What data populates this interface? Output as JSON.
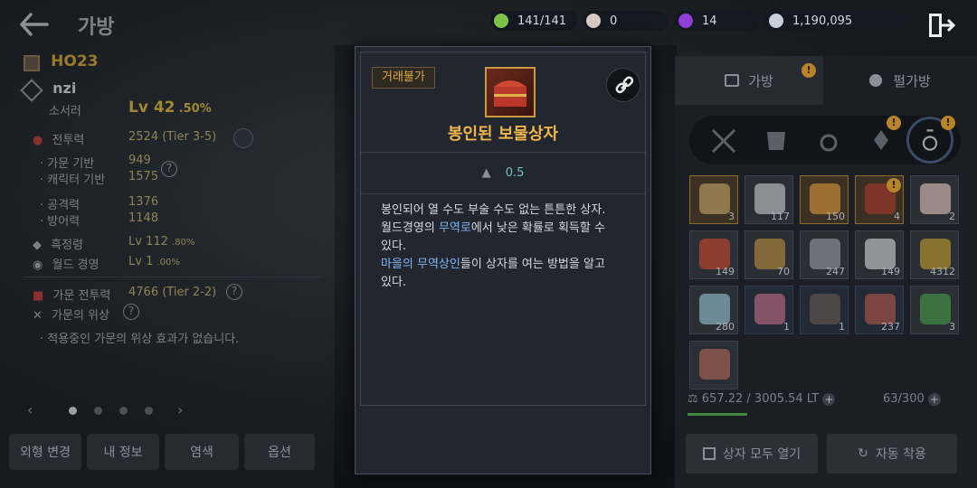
{
  "header": {
    "title": "가방",
    "back_icon": "back-arrow-icon",
    "exit_icon": "exit-door-icon"
  },
  "currencies": [
    {
      "name": "stamina",
      "icon": "stamina-icon",
      "value": "141/141",
      "color": "#7fc24a"
    },
    {
      "name": "pearl",
      "icon": "pearl-icon",
      "value": "0",
      "color": "#d9c9c4"
    },
    {
      "name": "purple-crystal",
      "icon": "purple-crystal-icon",
      "value": "14",
      "color": "#8e3fd6"
    },
    {
      "name": "silver",
      "icon": "silver-coin-icon",
      "value": "1,190,095",
      "color": "#c8d0dc"
    }
  ],
  "character": {
    "guild_name": "HO23",
    "name": "nzi",
    "class": "소서러",
    "level": "Lv 42",
    "level_pct": ".50%",
    "stats": [
      {
        "label": "전투력",
        "value": "2524 (Tier 3-5)"
      },
      {
        "label": "가문 기반",
        "value": "949"
      },
      {
        "label": "캐릭터 기반",
        "value": "1575"
      },
      {
        "label": "공격력",
        "value": "1376"
      },
      {
        "label": "방어력",
        "value": "1148"
      },
      {
        "label": "흑정령",
        "value": "Lv 112",
        "pct": ".80%"
      },
      {
        "label": "월드 경영",
        "value": "Lv 1",
        "pct": ".00%"
      },
      {
        "label": "가문 전투력",
        "value": "4766 (Tier 2-2)"
      },
      {
        "label": "가문의 위상",
        "value": ""
      }
    ],
    "status_note": "적용중인 가문의 위상 효과가 없습니다."
  },
  "left_buttons": [
    "외형 변경",
    "내 정보",
    "염색",
    "옵션"
  ],
  "item_popup": {
    "badge": "거래불가",
    "title": "봉인된 보물상자",
    "weight": "0.5",
    "desc_line1": "봉인되어 열 수도 부술 수도 없는 튼튼한 상자.",
    "desc_line2_pre": "월드경영의 ",
    "desc_line2_hl": "무역로",
    "desc_line2_post": "에서 낮은 확률로 획득할 수",
    "desc_line3": "있다.",
    "desc_line4_hl": "마을의 무역상인",
    "desc_line4_post": "들이 상자를 여는 방법을 알고",
    "desc_line5": "있다."
  },
  "inventory": {
    "tabs": [
      {
        "label": "가방",
        "icon": "bag-icon",
        "alert": "!"
      },
      {
        "label": "펄가방",
        "icon": "pearl-bag-icon",
        "alert": ""
      }
    ],
    "categories": [
      {
        "icon": "crossed-swords-icon",
        "alert": ""
      },
      {
        "icon": "armor-icon",
        "alert": ""
      },
      {
        "icon": "ring-icon",
        "alert": ""
      },
      {
        "icon": "crystal-icon",
        "alert": "!"
      },
      {
        "icon": "potion-bag-icon",
        "alert": "!"
      }
    ],
    "slots": [
      {
        "count": "3",
        "icon": "scroll-icon",
        "color": "#c8a66a",
        "style": "gold",
        "alert": ""
      },
      {
        "count": "117",
        "icon": "shoe-icon",
        "color": "#cfcfd6",
        "style": "",
        "alert": ""
      },
      {
        "count": "150",
        "icon": "ore-pile-icon",
        "color": "#e09a3a",
        "style": "gold",
        "alert": ""
      },
      {
        "count": "4",
        "icon": "treasure-chest-icon",
        "color": "#a8392a",
        "style": "gold",
        "alert": "!"
      },
      {
        "count": "2",
        "icon": "cake-icon",
        "color": "#e8c8c0",
        "style": "",
        "alert": ""
      },
      {
        "count": "149",
        "icon": "red-potion-icon",
        "color": "#d0482a",
        "style": "",
        "alert": ""
      },
      {
        "count": "70",
        "icon": "maze-tile-icon",
        "color": "#c09040",
        "style": "",
        "alert": ""
      },
      {
        "count": "247",
        "icon": "metal-plate-icon",
        "color": "#9aa0a8",
        "style": "",
        "alert": ""
      },
      {
        "count": "149",
        "icon": "cloth-icon",
        "color": "#d8d8dc",
        "style": "",
        "alert": ""
      },
      {
        "count": "4312",
        "icon": "glowing-orb-icon",
        "color": "#c8a22a",
        "style": "",
        "alert": ""
      },
      {
        "count": "280",
        "icon": "rainbow-orb-icon",
        "color": "#9ac8d6",
        "style": "",
        "alert": ""
      },
      {
        "count": "1",
        "icon": "pink-crystal-icon",
        "color": "#c8708a",
        "style": "blue",
        "alert": ""
      },
      {
        "count": "1",
        "icon": "stone-icon",
        "color": "#6a5a52",
        "style": "blue",
        "alert": ""
      },
      {
        "count": "237",
        "icon": "food-bowl-icon",
        "color": "#b85a4a",
        "style": "blue",
        "alert": ""
      },
      {
        "count": "3",
        "icon": "green-bottle-icon",
        "color": "#4aa04a",
        "style": "",
        "alert": ""
      },
      {
        "count": "",
        "icon": "pet-bowl-icon",
        "color": "#b86a5a",
        "style": "",
        "alert": ""
      }
    ],
    "weight_text": "657.22 / 3005.54 LT",
    "slot_text": "63/300",
    "weight_fraction": 0.22,
    "open_all_label": "상자 모두 열기",
    "auto_equip_label": "자동 착용"
  }
}
